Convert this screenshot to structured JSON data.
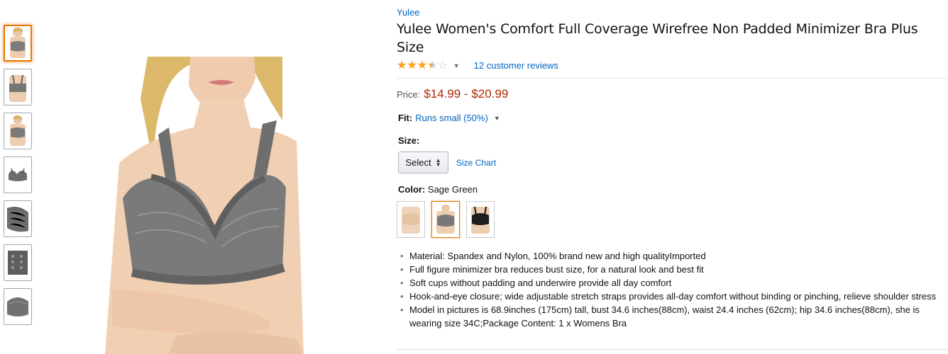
{
  "product": {
    "brand": "Yulee",
    "title": "Yulee Women's Comfort Full Coverage Wirefree Non Padded Minimizer Bra Plus Size",
    "rating": 3.5,
    "reviews_link": "12 customer reviews"
  },
  "price": {
    "label": "Price:",
    "value": "$14.99 - $20.99"
  },
  "fit": {
    "label": "Fit:",
    "value": "Runs small (50%)"
  },
  "size": {
    "label": "Size:",
    "select_label": "Select",
    "size_chart": "Size Chart"
  },
  "color": {
    "label": "Color:",
    "value": "Sage Green",
    "swatches": [
      "beige",
      "sage-green",
      "black"
    ]
  },
  "bullets": [
    "Material: Spandex and Nylon, 100% brand new and high qualityImported",
    "Full figure minimizer bra reduces bust size, for a natural look and best fit",
    "Soft cups without padding and underwire provide all day comfort",
    "Hook-and-eye closure; wide adjustable stretch straps provides all-day comfort without binding or pinching, relieve shoulder stress",
    "Model in pictures is 68.9inches (175cm) tall, bust 34.6 inches(88cm), waist 24.4 inches (62cm); hip 34.6 inches(88cm), she is wearing size 34C;Package Content: 1 x Womens Bra"
  ],
  "colors": {
    "link": "#0066c0",
    "price": "#b12704",
    "star": "#ffa41c",
    "selected_border": "#e77600",
    "bra_gray": "#7a7a7a"
  }
}
